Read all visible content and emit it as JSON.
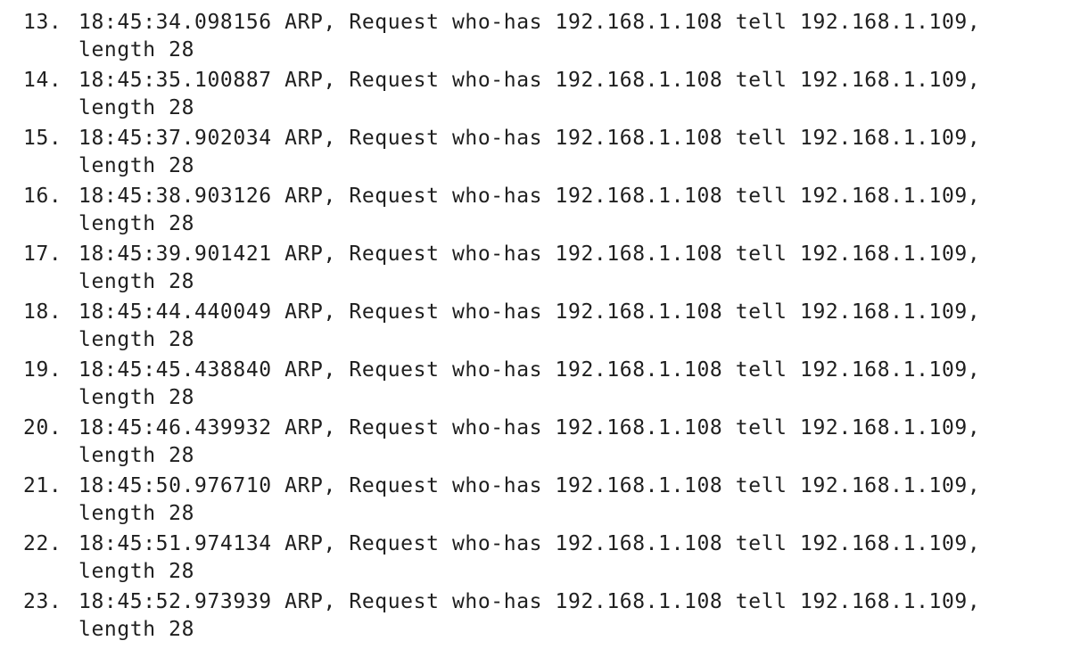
{
  "log": {
    "entries": [
      {
        "number": "13.",
        "line1": "18:45:34.098156 ARP, Request who-has 192.168.1.108 tell 192.168.1.109,",
        "line2": "length 28"
      },
      {
        "number": "14.",
        "line1": "18:45:35.100887 ARP, Request who-has 192.168.1.108 tell 192.168.1.109,",
        "line2": "length 28"
      },
      {
        "number": "15.",
        "line1": "18:45:37.902034 ARP, Request who-has 192.168.1.108 tell 192.168.1.109,",
        "line2": "length 28"
      },
      {
        "number": "16.",
        "line1": "18:45:38.903126 ARP, Request who-has 192.168.1.108 tell 192.168.1.109,",
        "line2": "length 28"
      },
      {
        "number": "17.",
        "line1": "18:45:39.901421 ARP, Request who-has 192.168.1.108 tell 192.168.1.109,",
        "line2": "length 28"
      },
      {
        "number": "18.",
        "line1": "18:45:44.440049 ARP, Request who-has 192.168.1.108 tell 192.168.1.109,",
        "line2": "length 28"
      },
      {
        "number": "19.",
        "line1": "18:45:45.438840 ARP, Request who-has 192.168.1.108 tell 192.168.1.109,",
        "line2": "length 28"
      },
      {
        "number": "20.",
        "line1": "18:45:46.439932 ARP, Request who-has 192.168.1.108 tell 192.168.1.109,",
        "line2": "length 28"
      },
      {
        "number": "21.",
        "line1": "18:45:50.976710 ARP, Request who-has 192.168.1.108 tell 192.168.1.109,",
        "line2": "length 28"
      },
      {
        "number": "22.",
        "line1": "18:45:51.974134 ARP, Request who-has 192.168.1.108 tell 192.168.1.109,",
        "line2": "length 28"
      },
      {
        "number": "23.",
        "line1": "18:45:52.973939 ARP, Request who-has 192.168.1.108 tell 192.168.1.109,",
        "line2": "length 28"
      }
    ]
  }
}
